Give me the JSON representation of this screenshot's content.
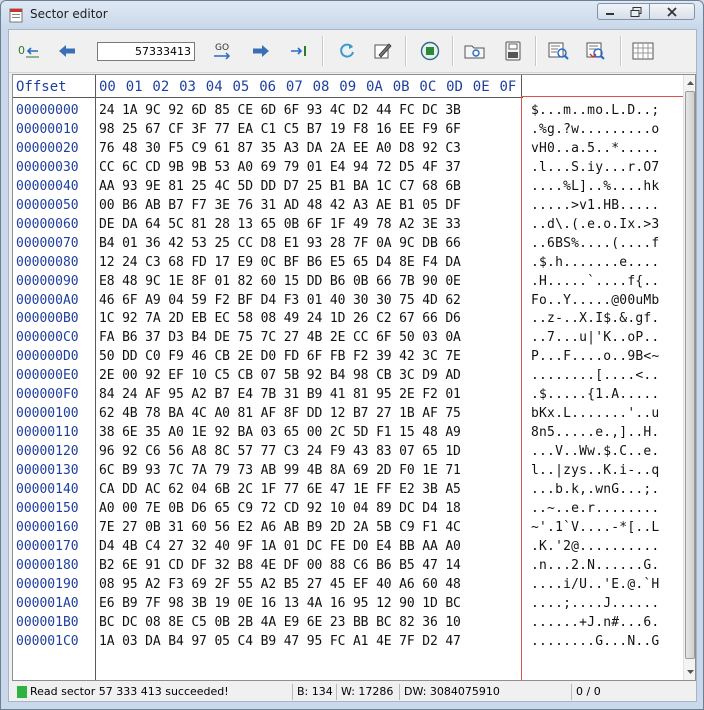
{
  "window": {
    "title": "Sector editor"
  },
  "toolbar": {
    "sector_value": "57333413",
    "go_label": "GO",
    "buttons": [
      "goto-start-icon",
      "back-arrow-icon",
      "go-icon",
      "forward-arrow-icon",
      "goto-end-icon",
      "refresh-icon",
      "edit-icon",
      "stop-icon",
      "open-folder-icon",
      "save-icon",
      "find-icon",
      "find-next-icon",
      "grid-icon"
    ]
  },
  "hexview": {
    "header": {
      "offset_label": "Offset",
      "columns": [
        "00",
        "01",
        "02",
        "03",
        "04",
        "05",
        "06",
        "07",
        "08",
        "09",
        "0A",
        "0B",
        "0C",
        "0D",
        "0E",
        "0F"
      ]
    },
    "rows": [
      {
        "offset": "00000000",
        "hex": "24 1A 9C 92 6D 85 CE 6D 6F 93 4C D2 44 FC DC 3B",
        "ascii": "$...m..mo.L.D..;"
      },
      {
        "offset": "00000010",
        "hex": "98 25 67 CF 3F 77 EA C1 C5 B7 19 F8 16 EE F9 6F",
        "ascii": ".%g.?w.........o"
      },
      {
        "offset": "00000020",
        "hex": "76 48 30 F5 C9 61 87 35 A3 DA 2A EE A0 D8 92 C3",
        "ascii": "vH0..a.5..*....."
      },
      {
        "offset": "00000030",
        "hex": "CC 6C CD 9B 9B 53 A0 69 79 01 E4 94 72 D5 4F 37",
        "ascii": ".l...S.iy...r.O7"
      },
      {
        "offset": "00000040",
        "hex": "AA 93 9E 81 25 4C 5D DD D7 25 B1 BA 1C C7 68 6B",
        "ascii": "....%L]..%....hk"
      },
      {
        "offset": "00000050",
        "hex": "00 B6 AB B7 F7 3E 76 31 AD 48 42 A3 AE B1 05 DF",
        "ascii": ".....>v1.HB....."
      },
      {
        "offset": "00000060",
        "hex": "DE DA 64 5C 81 28 13 65 0B 6F 1F 49 78 A2 3E 33",
        "ascii": "..d\\.(.e.o.Ix.>3"
      },
      {
        "offset": "00000070",
        "hex": "B4 01 36 42 53 25 CC D8 E1 93 28 7F 0A 9C DB 66",
        "ascii": "..6BS%....(....f"
      },
      {
        "offset": "00000080",
        "hex": "12 24 C3 68 FD 17 E9 0C BF B6 E5 65 D4 8E F4 DA",
        "ascii": ".$.h.......e...."
      },
      {
        "offset": "00000090",
        "hex": "E8 48 9C 1E 8F 01 82 60 15 DD B6 0B 66 7B 90 0E",
        "ascii": ".H.....`....f{.."
      },
      {
        "offset": "000000A0",
        "hex": "46 6F A9 04 59 F2 BF D4 F3 01 40 30 30 75 4D 62",
        "ascii": "Fo..Y.....@00uMb"
      },
      {
        "offset": "000000B0",
        "hex": "1C 92 7A 2D EB EC 58 08 49 24 1D 26 C2 67 66 D6",
        "ascii": "..z-..X.I$.&.gf."
      },
      {
        "offset": "000000C0",
        "hex": "FA B6 37 D3 B4 DE 75 7C 27 4B 2E CC 6F 50 03 0A",
        "ascii": "..7...u|'K..oP.."
      },
      {
        "offset": "000000D0",
        "hex": "50 DD C0 F9 46 CB 2E D0 FD 6F FB F2 39 42 3C 7E",
        "ascii": "P...F....o..9B<~"
      },
      {
        "offset": "000000E0",
        "hex": "2E 00 92 EF 10 C5 CB 07 5B 92 B4 98 CB 3C D9 AD",
        "ascii": "........[....<.."
      },
      {
        "offset": "000000F0",
        "hex": "84 24 AF 95 A2 B7 E4 7B 31 B9 41 81 95 2E F2 01",
        "ascii": ".$.....{1.A....."
      },
      {
        "offset": "00000100",
        "hex": "62 4B 78 BA 4C A0 81 AF 8F DD 12 B7 27 1B AF 75",
        "ascii": "bKx.L.......'..u"
      },
      {
        "offset": "00000110",
        "hex": "38 6E 35 A0 1E 92 BA 03 65 00 2C 5D F1 15 48 A9",
        "ascii": "8n5.....e.,]..H."
      },
      {
        "offset": "00000120",
        "hex": "96 92 C6 56 A8 8C 57 77 C3 24 F9 43 83 07 65 1D",
        "ascii": "...V..Ww.$.C..e."
      },
      {
        "offset": "00000130",
        "hex": "6C B9 93 7C 7A 79 73 AB 99 4B 8A 69 2D F0 1E 71",
        "ascii": "l..|zys..K.i-..q"
      },
      {
        "offset": "00000140",
        "hex": "CA DD AC 62 04 6B 2C 1F 77 6E 47 1E FF E2 3B A5",
        "ascii": "...b.k,.wnG...;."
      },
      {
        "offset": "00000150",
        "hex": "A0 00 7E 0B D6 65 C9 72 CD 92 10 04 89 DC D4 18",
        "ascii": "..~..e.r........"
      },
      {
        "offset": "00000160",
        "hex": "7E 27 0B 31 60 56 E2 A6 AB B9 2D 2A 5B C9 F1 4C",
        "ascii": "~'.1`V....-*[..L"
      },
      {
        "offset": "00000170",
        "hex": "D4 4B C4 27 32 40 9F 1A 01 DC FE D0 E4 BB AA A0",
        "ascii": ".K.'2@.........."
      },
      {
        "offset": "00000180",
        "hex": "B2 6E 91 CD DF 32 B8 4E DF 00 88 C6 B6 B5 47 14",
        "ascii": ".n...2.N......G."
      },
      {
        "offset": "00000190",
        "hex": "08 95 A2 F3 69 2F 55 A2 B5 27 45 EF 40 A6 60 48",
        "ascii": "....i/U..'E.@.`H"
      },
      {
        "offset": "000001A0",
        "hex": "E6 B9 7F 98 3B 19 0E 16 13 4A 16 95 12 90 1D BC",
        "ascii": "....;....J......"
      },
      {
        "offset": "000001B0",
        "hex": "BC DC 08 8E C5 0B 2B 4A E9 6E 23 BB BC 82 36 10",
        "ascii": "......+J.n#...6."
      },
      {
        "offset": "000001C0",
        "hex": "1A 03 DA B4 97 05 C4 B9 47 95 FC A1 4E 7F D2 47",
        "ascii": "........G...N..G"
      }
    ]
  },
  "status": {
    "message": "Read sector 57 333 413 succeeded!",
    "byte": "B: 134",
    "word": "W: 17286",
    "dword": "DW: 3084075910",
    "position": "0 / 0",
    "led_color": "#2fb340"
  }
}
